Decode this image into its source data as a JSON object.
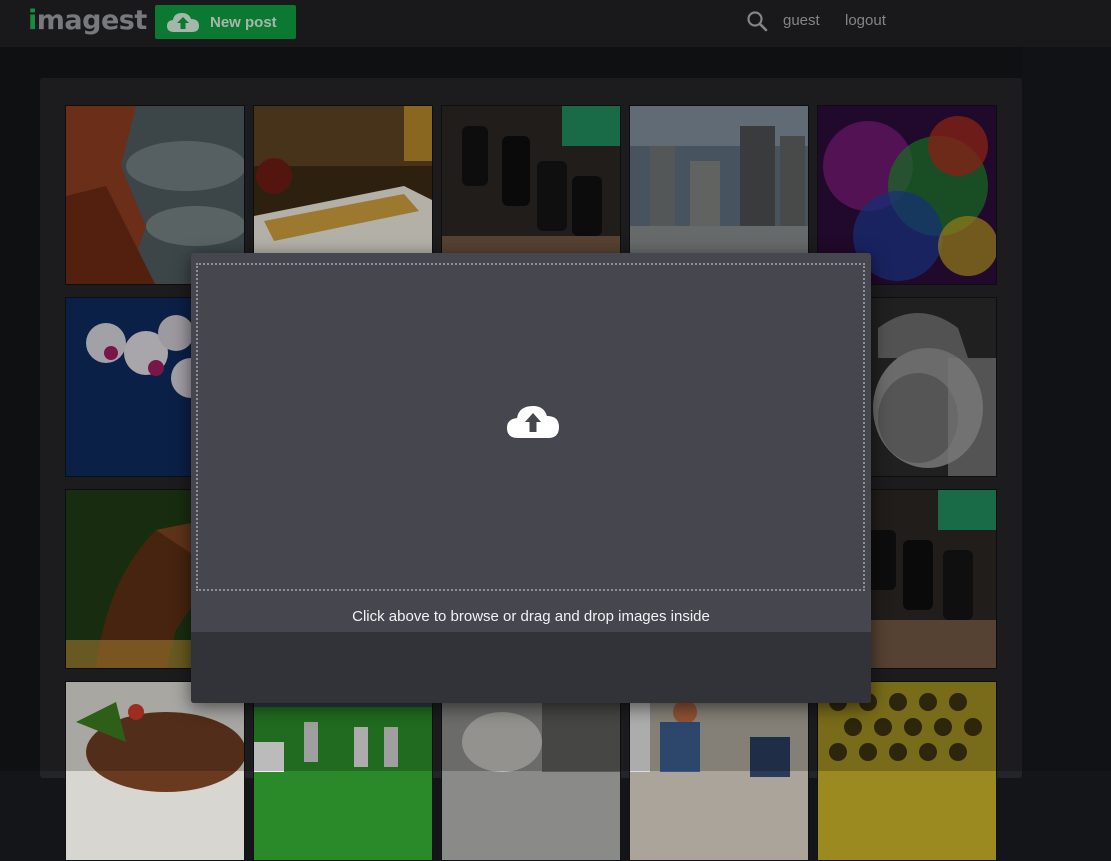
{
  "app": {
    "logo_text_accent": "i",
    "logo_text_rest": "magest"
  },
  "header": {
    "new_post_label": "New post",
    "search_icon": "search-icon",
    "user_label": "guest",
    "logout_label": "logout"
  },
  "colors": {
    "brand_green": "#0f9b40",
    "topbar": "#202124",
    "panel": "#242528",
    "modal": "#45464e"
  },
  "gallery": {
    "items": [
      {
        "subject": "coastline with red rocks"
      },
      {
        "subject": "flatbread appetizer"
      },
      {
        "subject": "electronic capacitors"
      },
      {
        "subject": "city skyline"
      },
      {
        "subject": "colorful smoke"
      },
      {
        "subject": "pink orchids"
      },
      {
        "subject": ""
      },
      {
        "subject": ""
      },
      {
        "subject": ""
      },
      {
        "subject": "elderly man portrait"
      },
      {
        "subject": "brown horse"
      },
      {
        "subject": ""
      },
      {
        "subject": ""
      },
      {
        "subject": ""
      },
      {
        "subject": "electronic capacitors"
      },
      {
        "subject": "grilled meat dish"
      },
      {
        "subject": "track runners"
      },
      {
        "subject": "seated person"
      },
      {
        "subject": "street vendors"
      },
      {
        "subject": "yellow pattern"
      }
    ]
  },
  "upload_modal": {
    "icon": "cloud-upload-icon",
    "instructions": "Click above to browse or drag and drop images inside"
  }
}
